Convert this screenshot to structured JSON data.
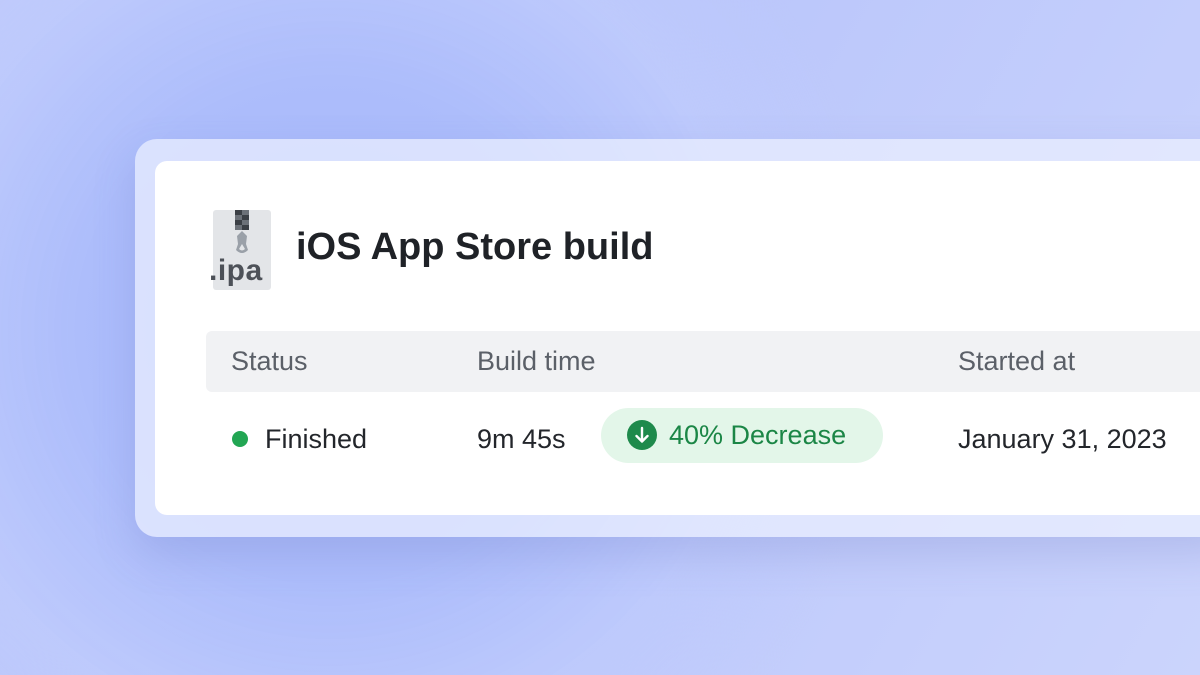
{
  "build": {
    "title": "iOS App Store build",
    "file_icon": "zip-file-icon",
    "file_extension": ".ipa"
  },
  "table": {
    "headers": {
      "status": "Status",
      "build_time": "Build time",
      "started_at": "Started at"
    },
    "row": {
      "status": "Finished",
      "status_color": "#22a653",
      "build_time": "9m 45s",
      "change_badge": {
        "icon": "arrow-down-circle-icon",
        "label": "40% Decrease",
        "color": "#1b8646",
        "background": "#e3f6e9"
      },
      "started_at": "January 31, 2023"
    }
  }
}
